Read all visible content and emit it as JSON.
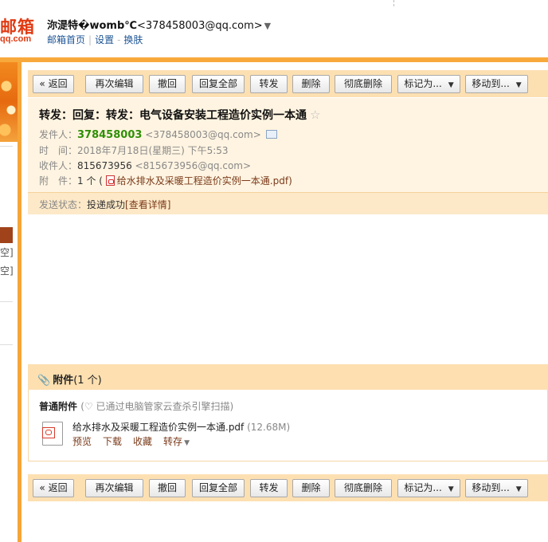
{
  "header": {
    "logo_main": "邮箱",
    "logo_sub": "qq.com",
    "user_name": "沵湜特�womb℃",
    "user_email": "<378458003@qq.com>",
    "links": [
      "邮箱首页",
      "设置",
      "换肤"
    ]
  },
  "left_panel": {
    "item1": "空]",
    "item2": "空]"
  },
  "toolbar": {
    "back": "« 返回",
    "reedit": "再次编辑",
    "undo": "撤回",
    "reply_all": "回复全部",
    "forward": "转发",
    "delete": "删除",
    "perm_delete": "彻底删除",
    "mark_as": "标记为...",
    "move_to": "移动到..."
  },
  "mail": {
    "subject": "转发：回复：转发：电气设备安装工程造价实例一本通",
    "from_label": "发件人：",
    "from_name": "378458003",
    "from_email": "<378458003@qq.com>",
    "time_label": "时　间：",
    "time_value": "2018年7月18日(星期三) 下午5:53",
    "to_label": "收件人：",
    "to_name": "815673956",
    "to_email": "<815673956@qq.com>",
    "att_label": "附　件：",
    "att_count": "1 个 (",
    "att_file": "给水排水及采暖工程造价实例一本通.pdf",
    "att_close": ")",
    "status_label": "发送状态：",
    "status_value": "投递成功",
    "status_link": "[查看详情]"
  },
  "attachments": {
    "title": "附件",
    "count": "(1 个)",
    "kind": "普通附件",
    "scan_note": "(♡ 已通过电脑管家云查杀引擎扫描)",
    "file_name": "给水排水及采暖工程造价实例一本通.pdf",
    "file_size": "(12.68M)",
    "actions": {
      "preview": "预览",
      "download": "下载",
      "collect": "收藏",
      "save_to": "转存"
    }
  }
}
